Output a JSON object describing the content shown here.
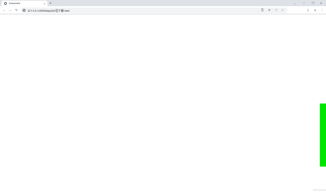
{
  "tab": {
    "title": "Document",
    "close_glyph": "×",
    "favicon": "globe-icon"
  },
  "new_tab_glyph": "+",
  "window_controls": {
    "chevron": "⌄",
    "minimize": "–",
    "maximize": "❐",
    "close": "✕"
  },
  "toolbar": {
    "back": "←",
    "forward": "→",
    "reload": "↻",
    "url": "127.0.0.1:5500/day16/2怎个精.html",
    "translate": "⎘",
    "zoom": "⊕",
    "share": "⇪",
    "bookmark": "☆",
    "side_panel": "▯",
    "profile": "●",
    "menu": "⋮"
  },
  "content": {
    "bar_color": "#00e600",
    "watermark": "CSDN @Genius"
  }
}
